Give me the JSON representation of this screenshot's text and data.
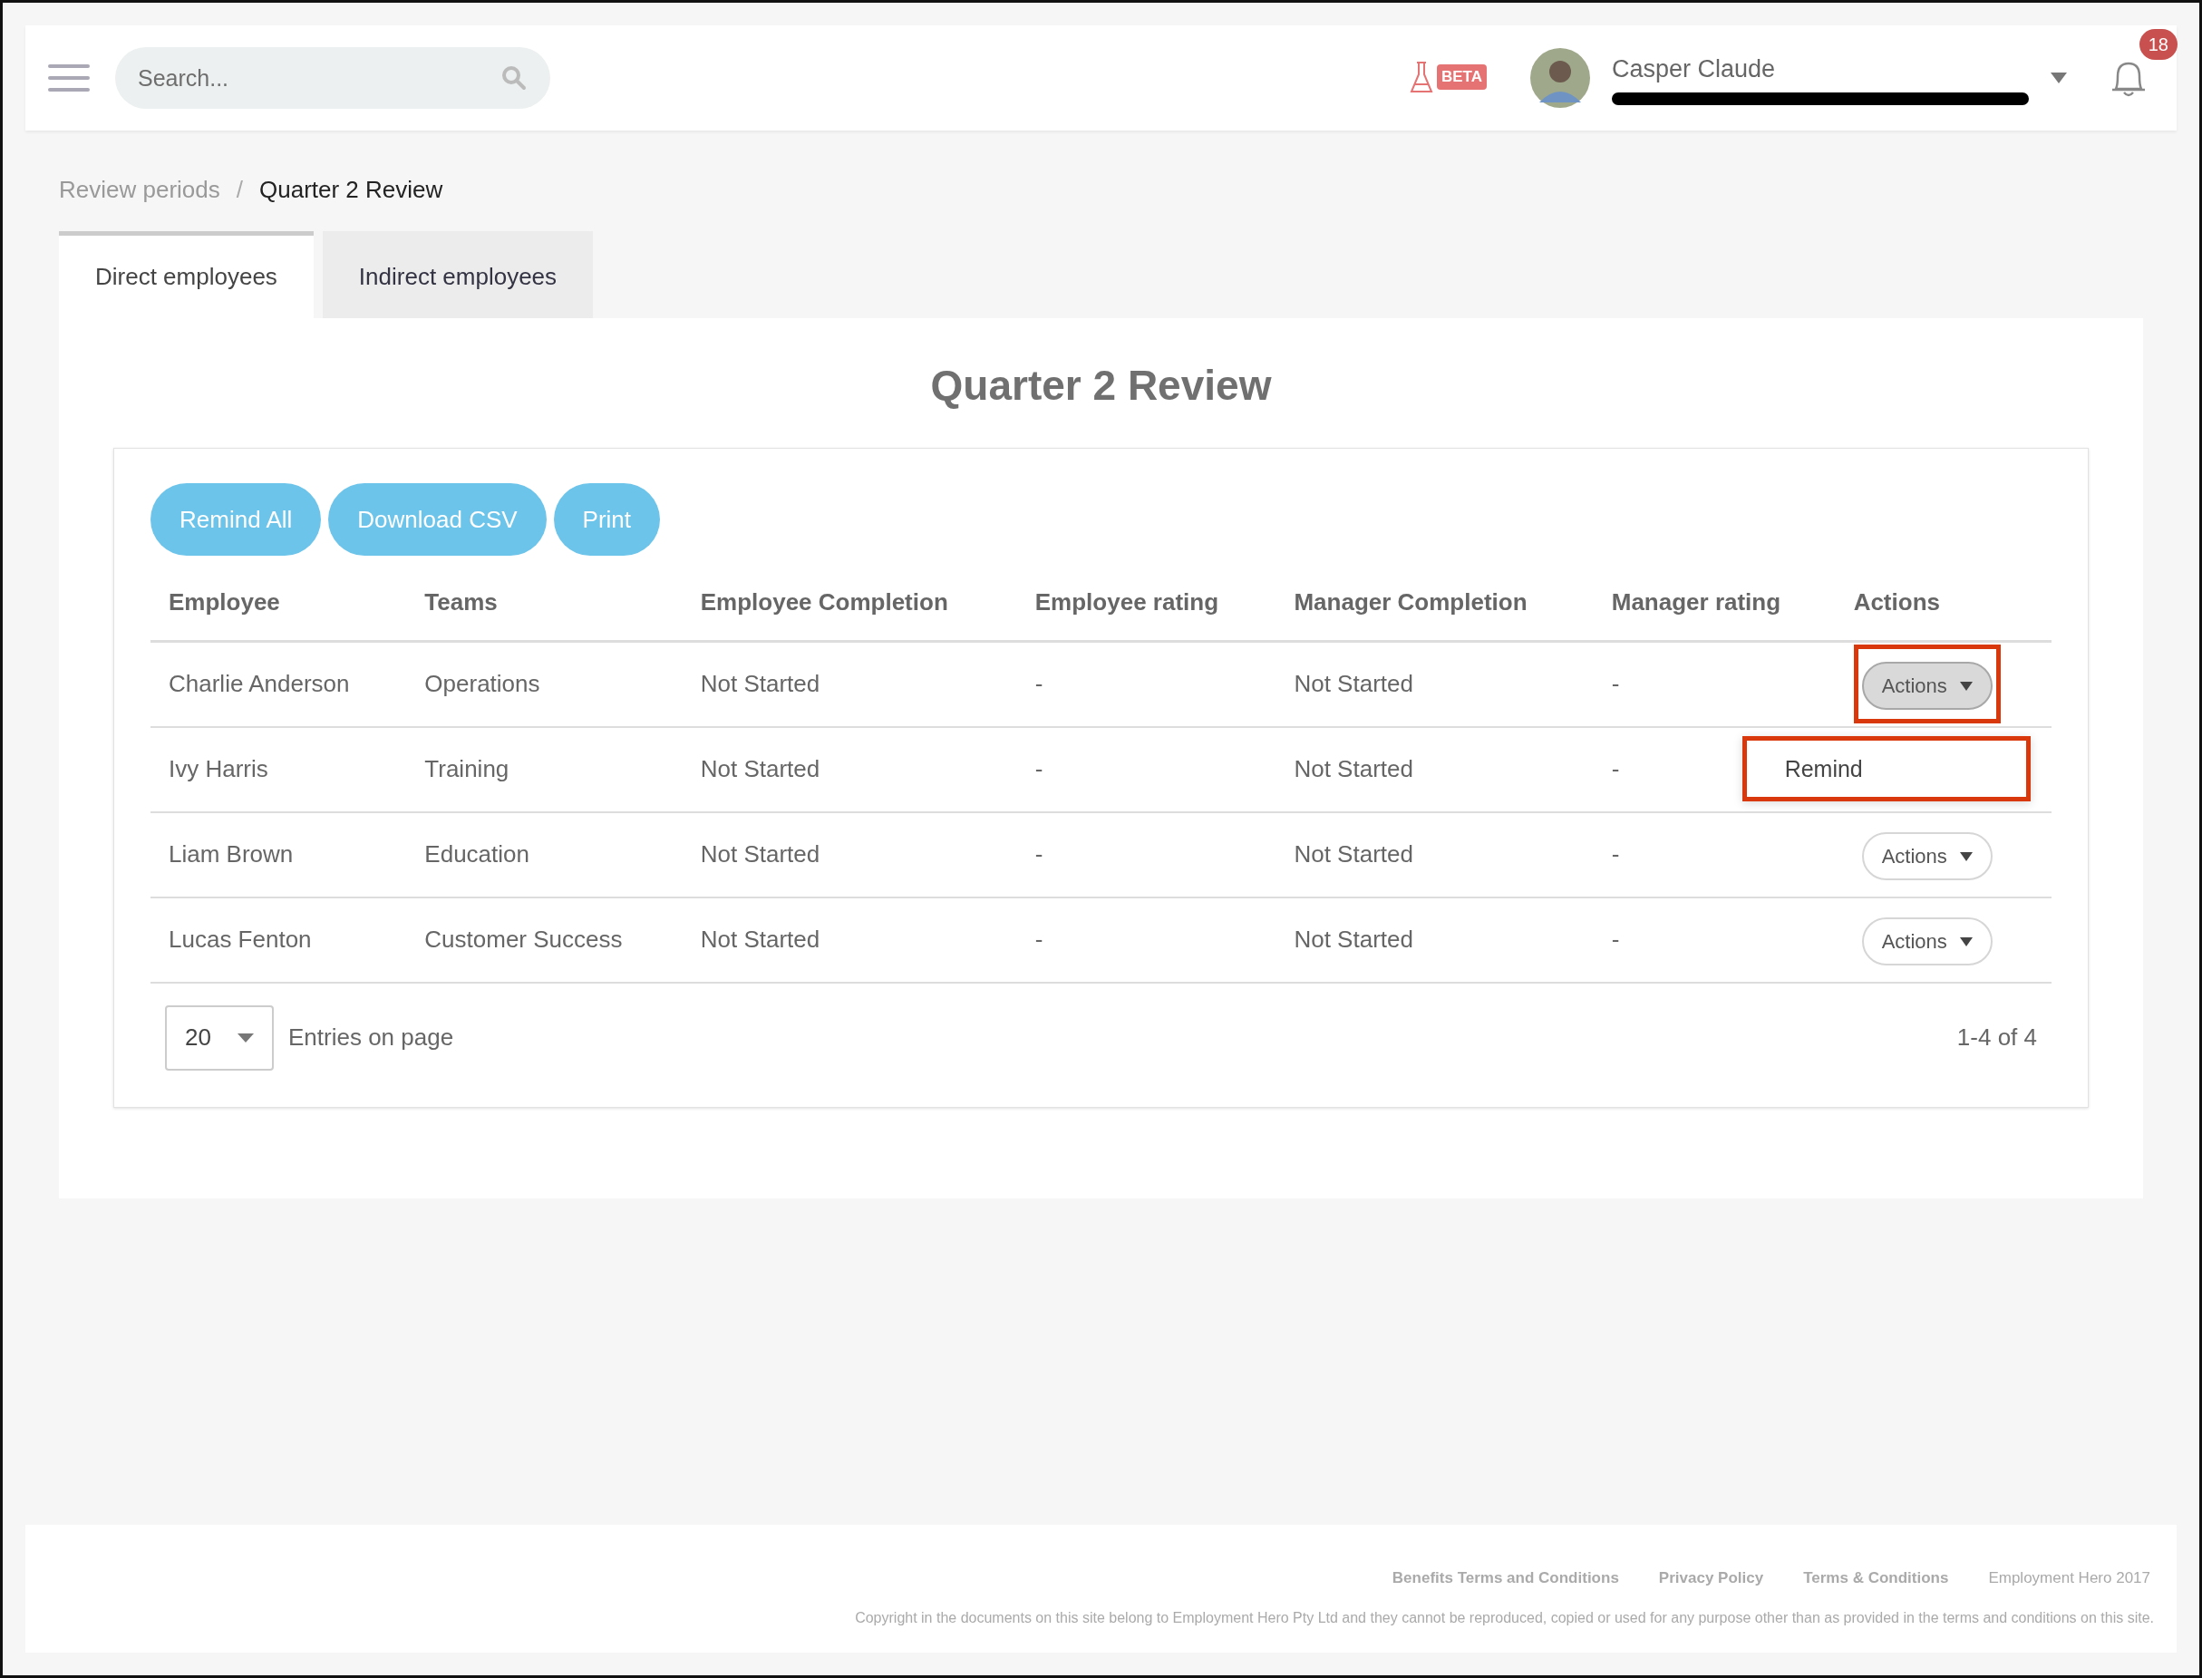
{
  "header": {
    "search": {
      "placeholder": "Search..."
    },
    "beta_badge": "BETA",
    "user": {
      "name": "Casper Claude",
      "email_redacted": true
    },
    "notifications": {
      "count": "18"
    }
  },
  "breadcrumb": [
    {
      "label": "Review periods",
      "current": false
    },
    {
      "separator": "/",
      "label": "Quarter 2 Review",
      "current": true
    }
  ],
  "tabs": [
    {
      "label": "Direct employees",
      "selected": true
    },
    {
      "label": "Indirect employees",
      "selected": false
    }
  ],
  "title": "Quarter 2 Review",
  "buttons": [
    "Remind All",
    "Download CSV",
    "Print"
  ],
  "table": {
    "columns": [
      "Employee",
      "Teams",
      "Employee Completion",
      "Employee rating",
      "Manager Completion",
      "Manager rating",
      "Actions"
    ],
    "rows": [
      {
        "cells": [
          "Charlie Anderson",
          "Operations",
          "Not Started",
          "-",
          "Not Started",
          "-"
        ],
        "action": "Actions",
        "open": true,
        "highlighted": true
      },
      {
        "cells": [
          "Ivy Harris",
          "Training",
          "Not Started",
          "-",
          "Not Started",
          "-"
        ]
      },
      {
        "cells": [
          "Liam Brown",
          "Education",
          "Not Started",
          "-",
          "Not Started",
          "-"
        ],
        "action": "Actions",
        "open": false,
        "highlighted": false
      },
      {
        "cells": [
          "Lucas Fenton",
          "Customer Success",
          "Not Started",
          "-",
          "Not Started",
          "-"
        ],
        "action": "Actions",
        "open": false,
        "highlighted": false
      }
    ]
  },
  "dropdown_menu": {
    "items": [
      "Remind"
    ],
    "highlighted": true
  },
  "pagination": {
    "page_size": "20",
    "label": "Entries on page",
    "range": "1-4 of 4"
  },
  "footer": {
    "links": [
      "Benefits Terms and Conditions",
      "Privacy Policy",
      "Terms & Conditions"
    ],
    "brand": "Employment Hero 2017",
    "copyright": "Copyright in the documents on this site belong to Employment Hero Pty Ltd and they cannot be reproduced, copied or used for any purpose other than as provided in the terms and conditions on this site."
  }
}
